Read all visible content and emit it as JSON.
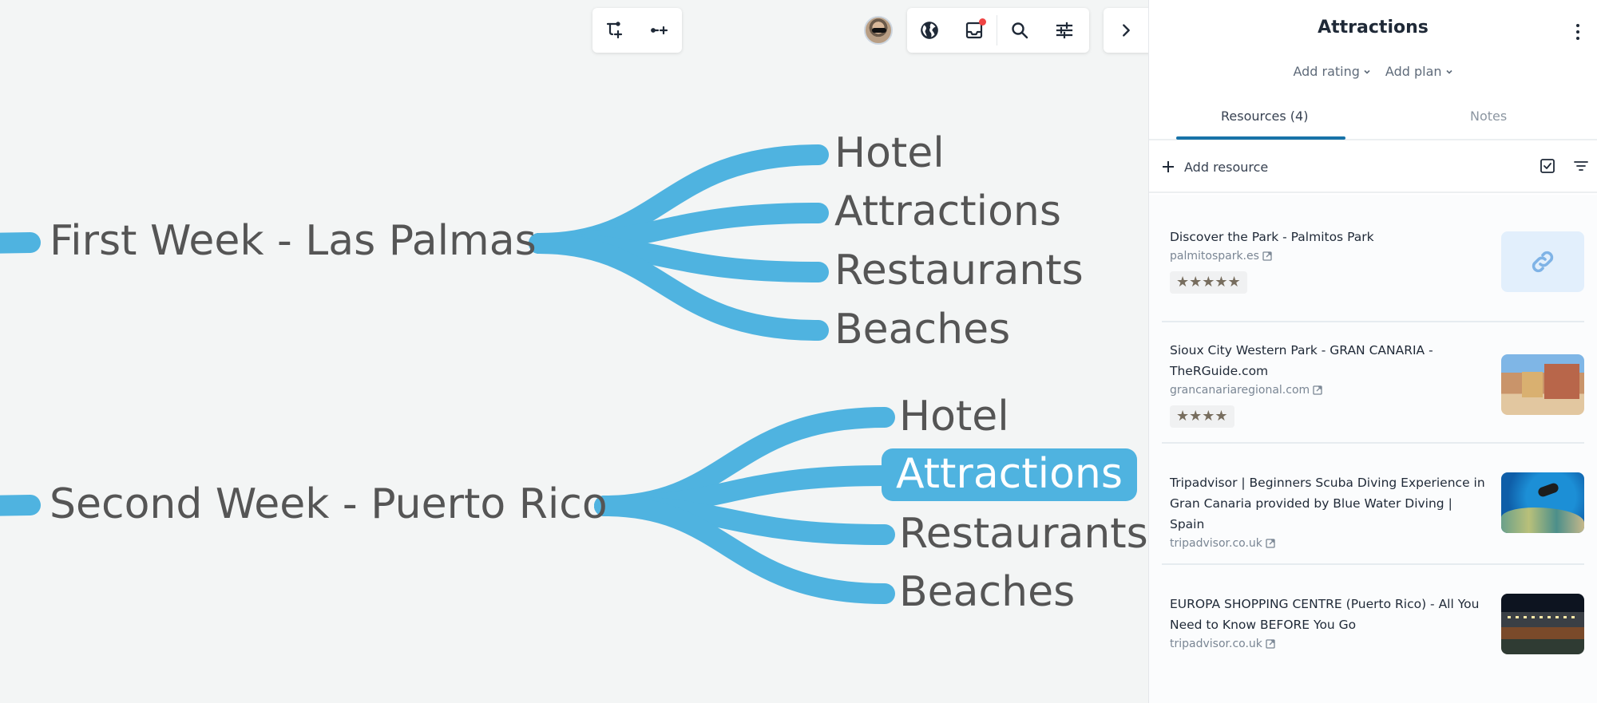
{
  "toolbar_left": {
    "buttons": [
      {
        "icon": "add-subtopic-icon",
        "label": "Add subtopic"
      },
      {
        "icon": "add-sibling-icon",
        "label": "Add sibling"
      }
    ]
  },
  "toolbar_right": {
    "avatar": "user-avatar",
    "buttons": [
      {
        "icon": "globe-icon",
        "label": "Share"
      },
      {
        "icon": "inbox-icon",
        "label": "Inbox",
        "badge": true
      },
      {
        "icon": "search-icon",
        "label": "Search"
      },
      {
        "icon": "sliders-icon",
        "label": "Settings"
      }
    ],
    "collapse": {
      "icon": "chevron-right-icon",
      "label": "Collapse panel"
    }
  },
  "mindmap": {
    "accent": "#4fb3e0",
    "groups": [
      {
        "label": "First Week - Las Palmas",
        "children": [
          "Hotel",
          "Attractions",
          "Restaurants",
          "Beaches"
        ],
        "selected_child": null
      },
      {
        "label": "Second Week - Puerto Rico",
        "children": [
          "Hotel",
          "Attractions",
          "Restaurants",
          "Beaches"
        ],
        "selected_child": 1
      }
    ]
  },
  "panel": {
    "title": "Attractions",
    "actions": [
      {
        "label": "Add rating"
      },
      {
        "label": "Add plan"
      }
    ],
    "tabs": [
      {
        "label": "Resources (4)",
        "active": true
      },
      {
        "label": "Notes",
        "active": false
      }
    ],
    "add_resource_label": "Add resource",
    "resources": [
      {
        "title": "Discover the Park - Palmitos Park",
        "domain": "palmitospark.es",
        "rating": 5,
        "stars": "★★★★★",
        "thumbnail": "link-placeholder"
      },
      {
        "title": "Sioux City Western Park - GRAN CANARIA - TheRGuide.com",
        "domain": "grancanariaregional.com",
        "rating": 4,
        "stars": "★★★★",
        "thumbnail": "western-town-photo"
      },
      {
        "title": "Tripadvisor | Beginners Scuba Diving Experience in Gran Canaria provided by Blue Water Diving | Spain",
        "domain": "tripadvisor.co.uk",
        "rating": null,
        "stars": null,
        "thumbnail": "scuba-diver-photo"
      },
      {
        "title": "EUROPA SHOPPING CENTRE (Puerto Rico) - All You Need to Know BEFORE You Go",
        "domain": "tripadvisor.co.uk",
        "rating": null,
        "stars": null,
        "thumbnail": "shopping-centre-night-photo"
      }
    ]
  }
}
